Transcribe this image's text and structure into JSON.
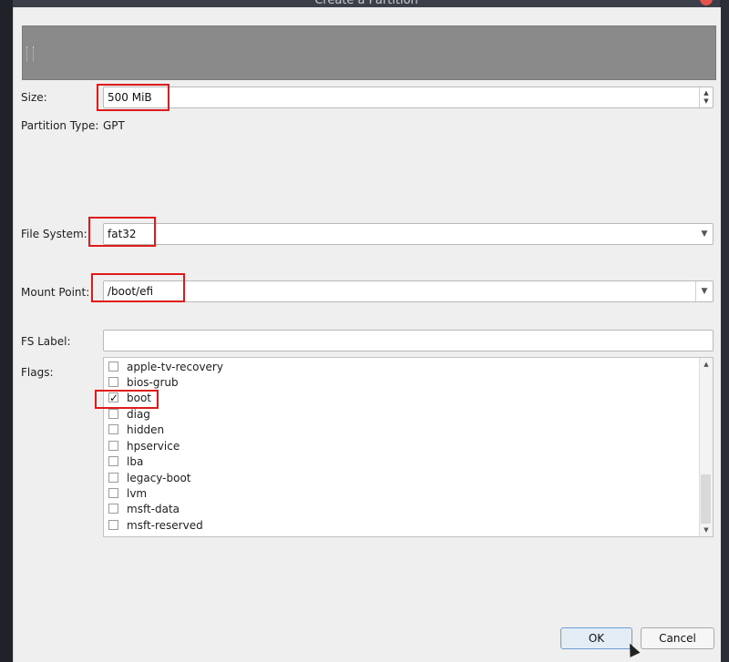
{
  "window": {
    "title": "Create a Partition"
  },
  "size": {
    "label": "Size:",
    "value": "500 MiB"
  },
  "partition_type": {
    "label": "Partition Type:",
    "value": "GPT"
  },
  "file_system": {
    "label": "File System:",
    "value": "fat32"
  },
  "mount_point": {
    "label": "Mount Point:",
    "value": "/boot/efi"
  },
  "fs_label": {
    "label": "FS Label:",
    "value": ""
  },
  "flags": {
    "label": "Flags:",
    "items": [
      {
        "name": "apple-tv-recovery",
        "checked": false
      },
      {
        "name": "bios-grub",
        "checked": false
      },
      {
        "name": "boot",
        "checked": true
      },
      {
        "name": "diag",
        "checked": false
      },
      {
        "name": "hidden",
        "checked": false
      },
      {
        "name": "hpservice",
        "checked": false
      },
      {
        "name": "lba",
        "checked": false
      },
      {
        "name": "legacy-boot",
        "checked": false
      },
      {
        "name": "lvm",
        "checked": false
      },
      {
        "name": "msft-data",
        "checked": false
      },
      {
        "name": "msft-reserved",
        "checked": false
      }
    ]
  },
  "buttons": {
    "ok": "OK",
    "cancel": "Cancel"
  },
  "colors": {
    "highlight": "#e0191b",
    "ok_border": "#6e9fd4"
  }
}
